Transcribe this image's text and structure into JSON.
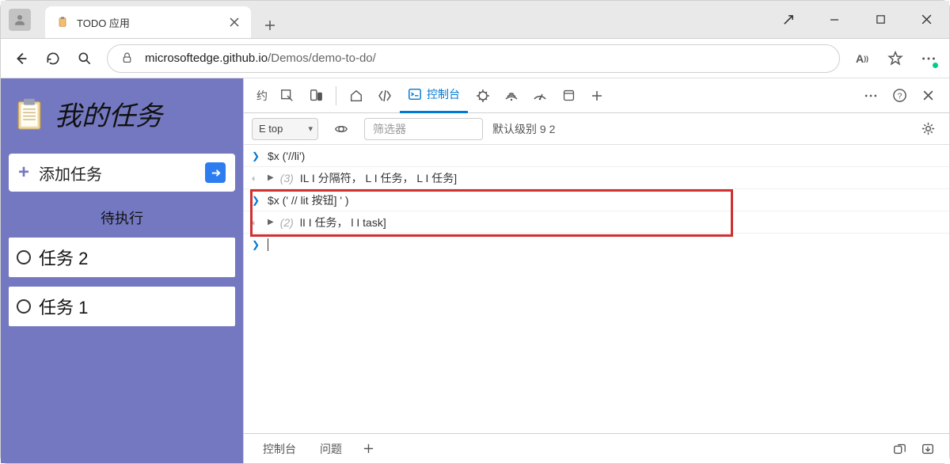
{
  "browser": {
    "tab_title": "TODO 应用",
    "url_host": "microsoftedge.github.io",
    "url_path": "/Demos/demo-to-do/"
  },
  "page": {
    "title": "我的任务",
    "add_task_label": "添加任务",
    "section_label": "待执行",
    "tasks": [
      {
        "label": "任务 2"
      },
      {
        "label": "任务 1"
      }
    ]
  },
  "devtools": {
    "toolbar_prefix": "约",
    "active_tab": "控制台",
    "context_label": "E top",
    "filter_placeholder": "筛选器",
    "level_label": "默认级别 9 2",
    "console_lines": [
      {
        "type": "input",
        "text": "$x ('//li')"
      },
      {
        "type": "output",
        "count": "(3)",
        "text": "IL I 分隔符，    L I 任务，    L I 任务]"
      },
      {
        "type": "input",
        "text": "$x (' // lit 按钮]       ' )"
      },
      {
        "type": "output",
        "count": "(2)",
        "text": "lI I 任务，    l I task]"
      }
    ],
    "bottom_tabs": {
      "console": "控制台",
      "issues": "问题"
    }
  }
}
